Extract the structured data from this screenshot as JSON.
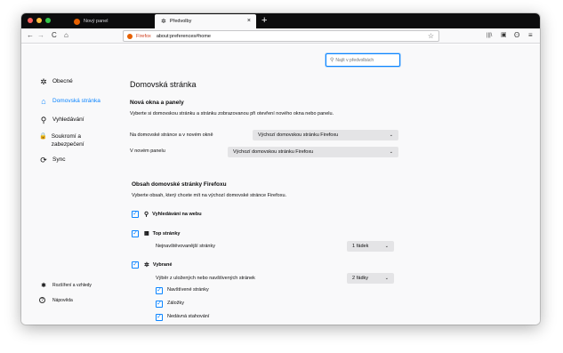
{
  "tabs": [
    {
      "label": "Nový panel",
      "close": "×"
    },
    {
      "label": "Předvolby",
      "close": "×"
    }
  ],
  "new_tab": "+",
  "nav": {
    "back": "←",
    "forward": "→",
    "reload": "C",
    "home": "⌂",
    "identity": "Firefox",
    "url": "about:preferences#home",
    "bookmark": "☆",
    "library": "|||\\",
    "sidebar": "▣",
    "account": "ʘ",
    "menu": "≡"
  },
  "search": {
    "placeholder": "Najít v předvolbách"
  },
  "sidebar": {
    "items": [
      {
        "icon": "✲",
        "label": "Obecné"
      },
      {
        "icon": "⌂",
        "label": "Domovská stránka"
      },
      {
        "icon": "⚲",
        "label": "Vyhledávání"
      },
      {
        "icon": "🔒",
        "label": "Soukromí a zabezpečení"
      },
      {
        "icon": "⟳",
        "label": "Sync"
      }
    ],
    "bottom": [
      {
        "icon": "✱",
        "label": "Rozšíření a vzhledy"
      },
      {
        "icon": "?",
        "label": "Nápověda"
      }
    ]
  },
  "main": {
    "title": "Domovská stránka",
    "section1": {
      "heading": "Nová okna a panely",
      "desc": "Vyberte si domovskou stránku a stránku zobrazovanou při otevření nového okna nebo panelu.",
      "row1_label": "Na domovské stránce a v novém okně",
      "row1_value": "Výchozí domovskou stránku Firefoxu",
      "row2_label": "V novém panelu",
      "row2_value": "Výchozí domovskou stránku Firefoxu"
    },
    "section2": {
      "heading": "Obsah domovské stránky Firefoxu",
      "desc": "Vyberte obsah, který chcete mít na výchozí domovské stránce Firefoxu.",
      "web_search": "Vyhledávání na webu",
      "top_sites": "Top stránky",
      "top_sites_desc": "Nejnavštěvovanější stránky",
      "top_sites_rows": "1 řádek",
      "highlights": "Vybrané",
      "highlights_desc": "Výběr z uložených nebo navštívených stránek",
      "highlights_rows": "2 řádky",
      "sub1": "Navštívené stránky",
      "sub2": "Záložky",
      "sub3": "Nedávná stahování"
    }
  },
  "check": "✓",
  "chevron": "⌄"
}
